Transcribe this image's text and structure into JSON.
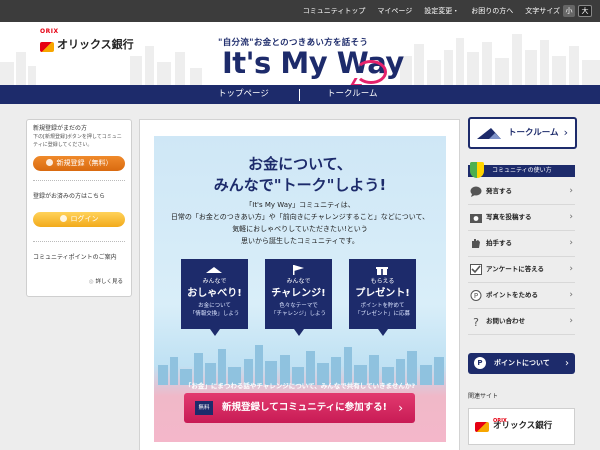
{
  "topbar": {
    "links": [
      "コミュニティトップ",
      "マイページ",
      "設定変更・",
      "お困りの方へ",
      "文字サイズ"
    ],
    "size_small": "小",
    "size_large": "大"
  },
  "header": {
    "brand_mark": "ORIX",
    "brand_name": "オリックス銀行",
    "tagline": "\"自分流\"お金とのつきあい方を話そう",
    "title": "It's My Way"
  },
  "nav": {
    "items": [
      "トップページ",
      "トークルーム"
    ]
  },
  "left": {
    "register_text": "新規登録がまだの方",
    "register_sub": "下の[新規登録]ボタンを押してコミュニティに登録してください。",
    "register_button": "新規登録（無料）",
    "login_text": "登録がお済みの方はこちら",
    "login_button": "ログイン",
    "points_title": "コミュニティポイントのご案内",
    "points_link": "詳しく見る"
  },
  "hero": {
    "title_line1": "お金について、",
    "title_line2": "みんなで\"トーク\"しよう!",
    "body": [
      "「It's My Way」コミュニティは、",
      "日常の「お金とのつきあい方」や「前向きにチャレンジすること」などについて、",
      "気軽におしゃべりしていただきたい!という",
      "思いから誕生したコミュニティです。"
    ],
    "cards": [
      {
        "small": "みんなで",
        "big": "おしゃべり!",
        "desc1": "お金について",
        "desc2": "「情報交換」しよう"
      },
      {
        "small": "みんなで",
        "big": "チャレンジ!",
        "desc1": "色々なテーマで",
        "desc2": "「チャレンジ」しよう"
      },
      {
        "small": "もらえる",
        "big": "プレゼント!",
        "desc1": "ポイントを貯めて",
        "desc2": "「プレゼント」に応募"
      }
    ],
    "banner_text": "「お金」にまつわる話やチャレンジについて、みんなで共有していきませんか?",
    "cta_tag": "無料",
    "cta_text": "新規登録してコミュニティに参加する!",
    "cta_arrow": "›"
  },
  "right": {
    "talk_button": "トークルーム",
    "guide_title": "コミュニティの使い方",
    "menu": [
      "発言する",
      "写真を投稿する",
      "拍手する",
      "アンケートに答える",
      "ポイントをためる",
      "お問い合わせ"
    ],
    "point_button": "ポイントについて",
    "related_title": "関連サイト",
    "related_name": "オリックス銀行",
    "related_mark": "ORIX"
  },
  "colors": {
    "navy": "#1d2b6b",
    "pink": "#e5226b",
    "orange": "#e07a1f",
    "yellow": "#f5b72a"
  }
}
